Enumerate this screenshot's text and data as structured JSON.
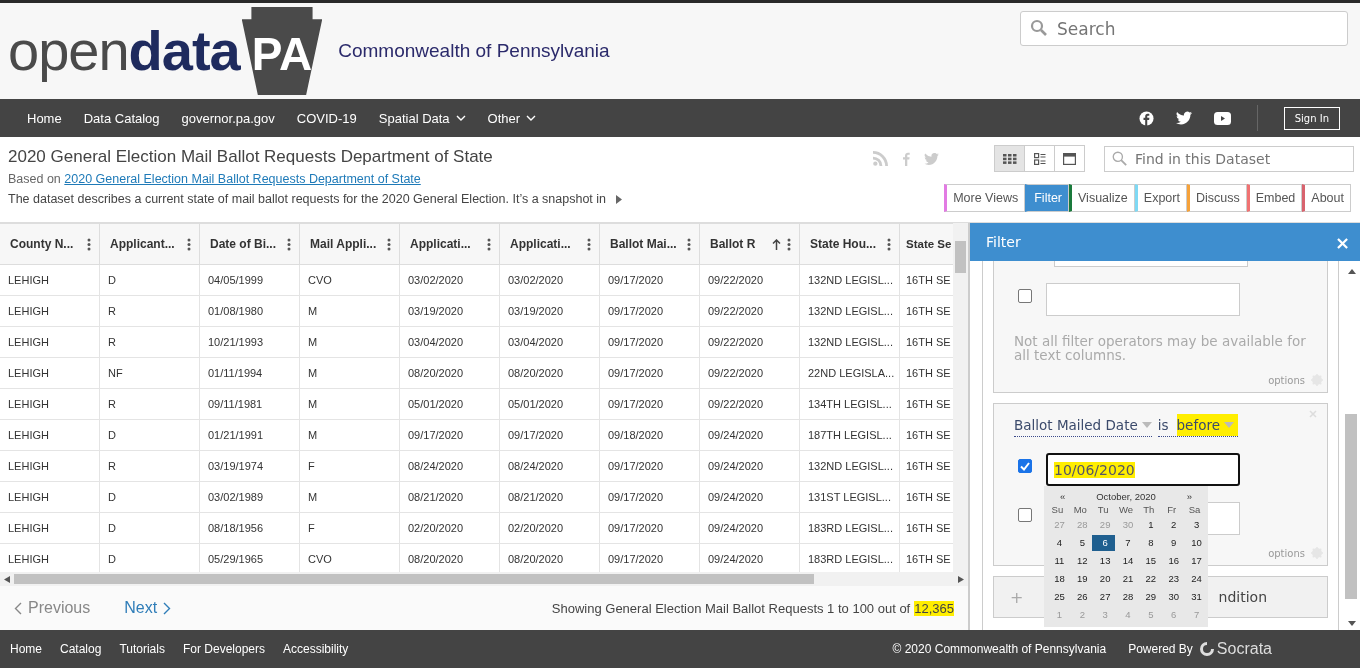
{
  "logo": {
    "part_1": "open",
    "part_2": "data",
    "badge": "PA"
  },
  "site_title": "Commonwealth of Pennsylvania",
  "search": {
    "placeholder": "Search"
  },
  "nav": [
    {
      "label": "Home",
      "dropdown": false
    },
    {
      "label": "Data Catalog",
      "dropdown": false
    },
    {
      "label": "governor.pa.gov",
      "dropdown": false
    },
    {
      "label": "COVID-19",
      "dropdown": false
    },
    {
      "label": "Spatial Data",
      "dropdown": true
    },
    {
      "label": "Other",
      "dropdown": true
    }
  ],
  "sign_in": "Sign In",
  "dataset": {
    "title": "2020 General Election Mail Ballot Requests Department of State",
    "based_on": "Based on",
    "source_link": "2020 General Election Mail Ballot Requests Department of State",
    "description": "The dataset describes a current state of mail ballot requests for the 2020 General Election. It’s a snapshot in"
  },
  "view_modes": [
    {
      "selected": true
    },
    {
      "selected": false
    },
    {
      "selected": false
    }
  ],
  "find": {
    "placeholder": "Find in this Dataset"
  },
  "tabs": [
    {
      "label": "More Views",
      "color": "#e27be3",
      "selected": false
    },
    {
      "label": "Filter",
      "color": "#3e8ecf",
      "selected": true
    },
    {
      "label": "Visualize",
      "color": "#1a7a3c",
      "selected": false
    },
    {
      "label": "Export",
      "color": "#7fd9f4",
      "selected": false
    },
    {
      "label": "Discuss",
      "color": "#f6a23a",
      "selected": false
    },
    {
      "label": "Embed",
      "color": "#f07272",
      "selected": false
    },
    {
      "label": "About",
      "color": "#d8636e",
      "selected": false
    }
  ],
  "table": {
    "columns": [
      {
        "label": "County N...",
        "sorted": false
      },
      {
        "label": "Applicant...",
        "sorted": false
      },
      {
        "label": "Date of Bi...",
        "sorted": false
      },
      {
        "label": "Mail Appli...",
        "sorted": false
      },
      {
        "label": "Applicati...",
        "sorted": false
      },
      {
        "label": "Applicati...",
        "sorted": false
      },
      {
        "label": "Ballot Mai...",
        "sorted": false
      },
      {
        "label": "Ballot R",
        "sorted": true
      },
      {
        "label": "State Hou...",
        "sorted": false
      },
      {
        "label": "State Se",
        "sorted": false
      }
    ],
    "rows": [
      [
        "LEHIGH",
        "D",
        "04/05/1999",
        "CVO",
        "03/02/2020",
        "03/02/2020",
        "09/17/2020",
        "09/22/2020",
        "132ND LEGISL...",
        "16TH SE"
      ],
      [
        "LEHIGH",
        "R",
        "01/08/1980",
        "M",
        "03/19/2020",
        "03/19/2020",
        "09/17/2020",
        "09/22/2020",
        "132ND LEGISL...",
        "16TH SE"
      ],
      [
        "LEHIGH",
        "R",
        "10/21/1993",
        "M",
        "03/04/2020",
        "03/04/2020",
        "09/17/2020",
        "09/22/2020",
        "132ND LEGISL...",
        "16TH SE"
      ],
      [
        "LEHIGH",
        "NF",
        "01/11/1994",
        "M",
        "08/20/2020",
        "08/20/2020",
        "09/17/2020",
        "09/22/2020",
        "22ND LEGISLA...",
        "16TH SE"
      ],
      [
        "LEHIGH",
        "R",
        "09/11/1981",
        "M",
        "05/01/2020",
        "05/01/2020",
        "09/17/2020",
        "09/22/2020",
        "134TH LEGISL...",
        "16TH SE"
      ],
      [
        "LEHIGH",
        "D",
        "01/21/1991",
        "M",
        "09/17/2020",
        "09/17/2020",
        "09/18/2020",
        "09/24/2020",
        "187TH LEGISL...",
        "16TH SE"
      ],
      [
        "LEHIGH",
        "R",
        "03/19/1974",
        "F",
        "08/24/2020",
        "08/24/2020",
        "09/17/2020",
        "09/24/2020",
        "132ND LEGISL...",
        "16TH SE"
      ],
      [
        "LEHIGH",
        "D",
        "03/02/1989",
        "M",
        "08/21/2020",
        "08/21/2020",
        "09/17/2020",
        "09/24/2020",
        "131ST LEGISL...",
        "16TH SE"
      ],
      [
        "LEHIGH",
        "D",
        "08/18/1956",
        "F",
        "02/20/2020",
        "02/20/2020",
        "09/17/2020",
        "09/24/2020",
        "183RD LEGISL...",
        "16TH SE"
      ],
      [
        "LEHIGH",
        "D",
        "05/29/1965",
        "CVO",
        "08/20/2020",
        "08/20/2020",
        "09/17/2020",
        "09/24/2020",
        "183RD LEGISL...",
        "16TH SE"
      ]
    ]
  },
  "pager": {
    "previous": "Previous",
    "next": "Next",
    "status": "Showing General Election Mail Ballot Requests 1 to 100 out of",
    "count": "12,365",
    "count_highlighted": true
  },
  "filter_panel": {
    "title": "Filter",
    "close": "×",
    "text_condition": {
      "checked": false,
      "note": "Not all filter operators may be available for all text columns.",
      "options": "options"
    },
    "date_condition": {
      "column": "Ballot Mailed Date",
      "operator_prefix": "is",
      "operator": "before",
      "operator_highlighted": true,
      "value": "10/06/2020",
      "value_highlighted": true,
      "checked": true,
      "second_checked": false,
      "options": "options"
    },
    "add_condition": {
      "icon": "+",
      "label": "ndition"
    },
    "calendar": {
      "month": "October, 2020",
      "prev": "«",
      "next": "»",
      "weekdays": [
        "Su",
        "Mo",
        "Tu",
        "We",
        "Th",
        "Fr",
        "Sa"
      ],
      "weeks": [
        [
          {
            "day": "27",
            "outside": true,
            "selected": false
          },
          {
            "day": "28",
            "outside": true,
            "selected": false
          },
          {
            "day": "29",
            "outside": true,
            "selected": false
          },
          {
            "day": "30",
            "outside": true,
            "selected": false
          },
          {
            "day": "1",
            "outside": false,
            "selected": false
          },
          {
            "day": "2",
            "outside": false,
            "selected": false
          },
          {
            "day": "3",
            "outside": false,
            "selected": false
          }
        ],
        [
          {
            "day": "4",
            "outside": false,
            "selected": false
          },
          {
            "day": "5",
            "outside": false,
            "selected": false
          },
          {
            "day": "6",
            "outside": false,
            "selected": true
          },
          {
            "day": "7",
            "outside": false,
            "selected": false
          },
          {
            "day": "8",
            "outside": false,
            "selected": false
          },
          {
            "day": "9",
            "outside": false,
            "selected": false
          },
          {
            "day": "10",
            "outside": false,
            "selected": false
          }
        ],
        [
          {
            "day": "11",
            "outside": false,
            "selected": false
          },
          {
            "day": "12",
            "outside": false,
            "selected": false
          },
          {
            "day": "13",
            "outside": false,
            "selected": false
          },
          {
            "day": "14",
            "outside": false,
            "selected": false
          },
          {
            "day": "15",
            "outside": false,
            "selected": false
          },
          {
            "day": "16",
            "outside": false,
            "selected": false
          },
          {
            "day": "17",
            "outside": false,
            "selected": false
          }
        ],
        [
          {
            "day": "18",
            "outside": false,
            "selected": false
          },
          {
            "day": "19",
            "outside": false,
            "selected": false
          },
          {
            "day": "20",
            "outside": false,
            "selected": false
          },
          {
            "day": "21",
            "outside": false,
            "selected": false
          },
          {
            "day": "22",
            "outside": false,
            "selected": false
          },
          {
            "day": "23",
            "outside": false,
            "selected": false
          },
          {
            "day": "24",
            "outside": false,
            "selected": false
          }
        ],
        [
          {
            "day": "25",
            "outside": false,
            "selected": false
          },
          {
            "day": "26",
            "outside": false,
            "selected": false
          },
          {
            "day": "27",
            "outside": false,
            "selected": false
          },
          {
            "day": "28",
            "outside": false,
            "selected": false
          },
          {
            "day": "29",
            "outside": false,
            "selected": false
          },
          {
            "day": "30",
            "outside": false,
            "selected": false
          },
          {
            "day": "31",
            "outside": false,
            "selected": false
          }
        ],
        [
          {
            "day": "1",
            "outside": true,
            "selected": false
          },
          {
            "day": "2",
            "outside": true,
            "selected": false
          },
          {
            "day": "3",
            "outside": true,
            "selected": false
          },
          {
            "day": "4",
            "outside": true,
            "selected": false
          },
          {
            "day": "5",
            "outside": true,
            "selected": false
          },
          {
            "day": "6",
            "outside": true,
            "selected": false
          },
          {
            "day": "7",
            "outside": true,
            "selected": false
          }
        ]
      ]
    }
  },
  "footer": {
    "links": [
      "Home",
      "Catalog",
      "Tutorials",
      "For Developers",
      "Accessibility"
    ],
    "copyright": "© 2020 Commonwealth of Pennsylvania",
    "powered_by": "Powered By",
    "brand": "Socrata"
  }
}
